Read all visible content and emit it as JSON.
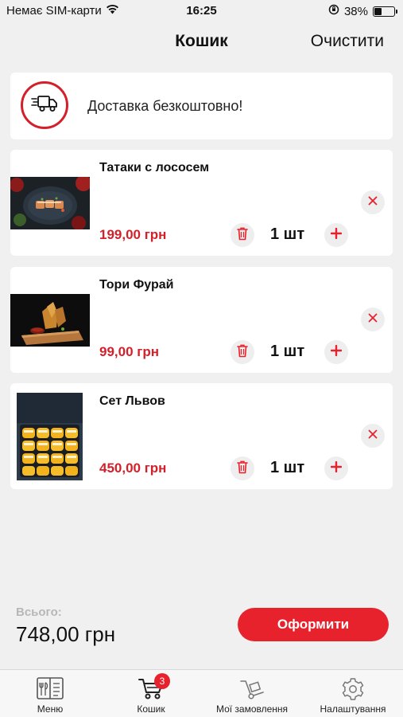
{
  "status_bar": {
    "carrier": "Немає SIM-карти",
    "time": "16:25",
    "battery": "38%",
    "battery_level": 0.38
  },
  "header": {
    "title": "Кошик",
    "clear_label": "Очистити"
  },
  "delivery": {
    "text": "Доставка безкоштовно!",
    "icon": "delivery-truck-icon"
  },
  "cart": {
    "items": [
      {
        "name": "Татаки с лососем",
        "price": "199,00 грн",
        "quantity": "1 шт"
      },
      {
        "name": "Тори Фурай",
        "price": "99,00 грн",
        "quantity": "1 шт"
      },
      {
        "name": "Сет Львов",
        "price": "450,00 грн",
        "quantity": "1 шт"
      }
    ]
  },
  "footer": {
    "total_label": "Всього:",
    "total_value": "748,00 грн",
    "checkout_label": "Оформити"
  },
  "tabs": [
    {
      "label": "Меню",
      "icon": "menu-book-icon"
    },
    {
      "label": "Кошик",
      "icon": "cart-icon",
      "badge": "3"
    },
    {
      "label": "Мої замовлення",
      "icon": "hand-truck-icon"
    },
    {
      "label": "Налаштування",
      "icon": "gear-icon"
    }
  ],
  "colors": {
    "accent": "#e8222d",
    "price": "#d4202a",
    "background": "#f0f0f0",
    "card": "#ffffff"
  }
}
